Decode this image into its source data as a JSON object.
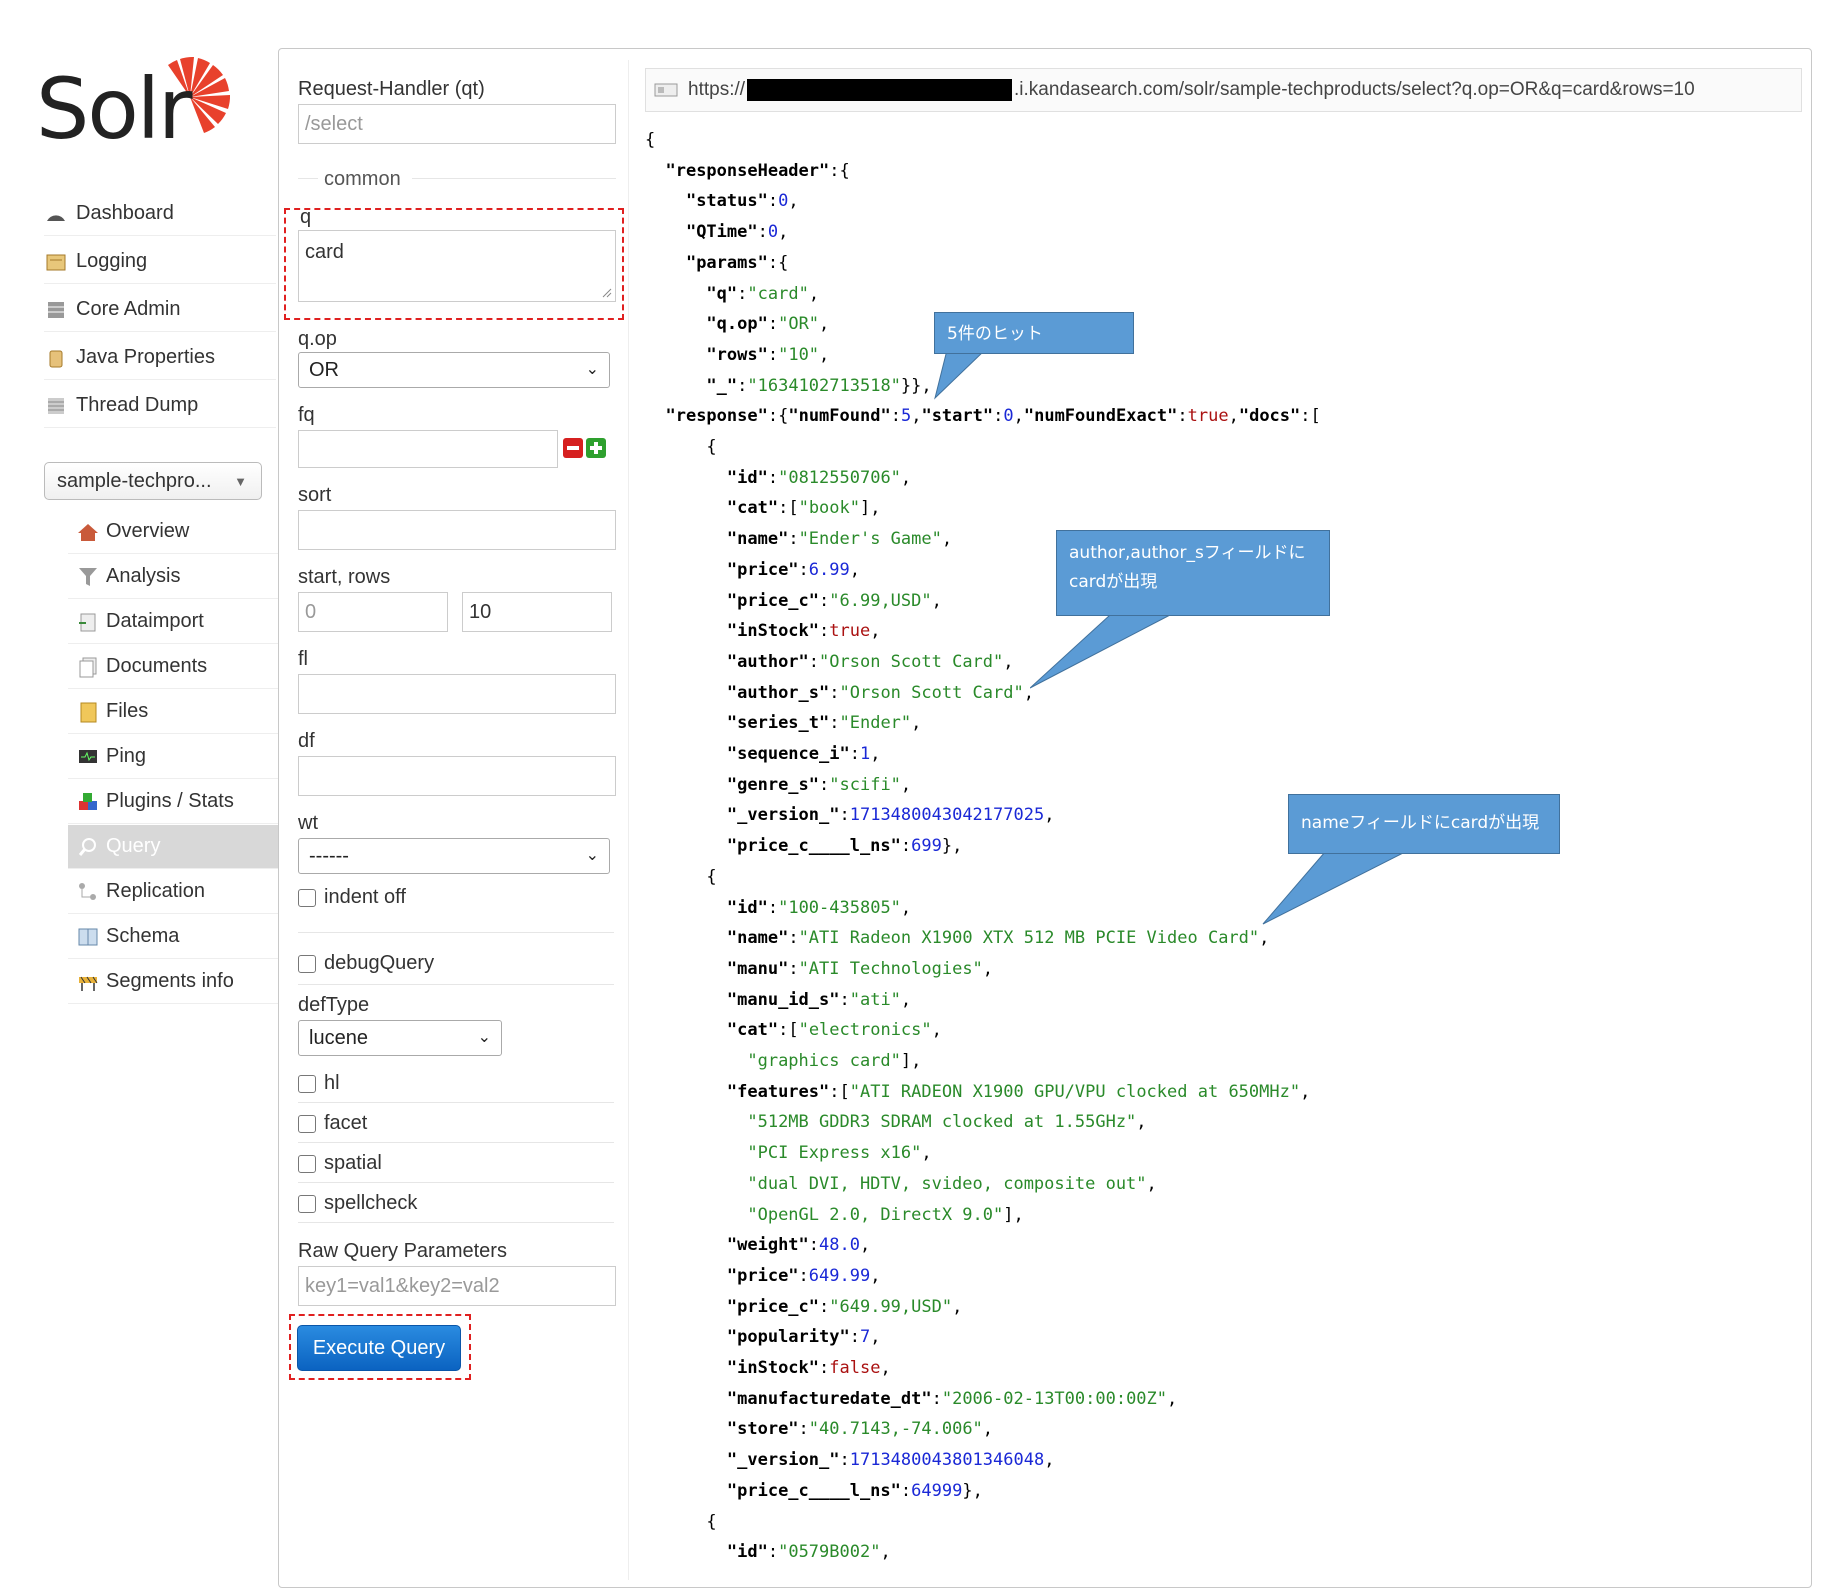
{
  "logo_text": "Solr",
  "sidebar": {
    "items": [
      {
        "label": "Dashboard",
        "icon": "dashboard-icon"
      },
      {
        "label": "Logging",
        "icon": "logging-icon"
      },
      {
        "label": "Core Admin",
        "icon": "core-admin-icon"
      },
      {
        "label": "Java Properties",
        "icon": "java-properties-icon"
      },
      {
        "label": "Thread Dump",
        "icon": "thread-dump-icon"
      }
    ],
    "core_selector": "sample-techpro...",
    "core_items": [
      {
        "label": "Overview",
        "icon": "overview-icon"
      },
      {
        "label": "Analysis",
        "icon": "analysis-icon"
      },
      {
        "label": "Dataimport",
        "icon": "dataimport-icon"
      },
      {
        "label": "Documents",
        "icon": "documents-icon"
      },
      {
        "label": "Files",
        "icon": "files-icon"
      },
      {
        "label": "Ping",
        "icon": "ping-icon"
      },
      {
        "label": "Plugins / Stats",
        "icon": "plugins-icon"
      },
      {
        "label": "Query",
        "icon": "query-icon",
        "active": true
      },
      {
        "label": "Replication",
        "icon": "replication-icon"
      },
      {
        "label": "Schema",
        "icon": "schema-icon"
      },
      {
        "label": "Segments info",
        "icon": "segments-icon"
      }
    ]
  },
  "form": {
    "handler_label": "Request-Handler (qt)",
    "handler_placeholder": "/select",
    "common_label": "common",
    "q_label": "q",
    "q_value": "card",
    "qop_label": "q.op",
    "qop_value": "OR",
    "fq_label": "fq",
    "sort_label": "sort",
    "start_rows_label": "start, rows",
    "start_placeholder": "0",
    "rows_value": "10",
    "fl_label": "fl",
    "df_label": "df",
    "wt_label": "wt",
    "wt_value": "------",
    "indent_label": "indent off",
    "debug_label": "debugQuery",
    "deftype_label": "defType",
    "deftype_value": "lucene",
    "hl_label": "hl",
    "facet_label": "facet",
    "spatial_label": "spatial",
    "spellcheck_label": "spellcheck",
    "raw_label": "Raw Query Parameters",
    "raw_placeholder": "key1=val1&key2=val2",
    "execute_label": "Execute Query"
  },
  "url": {
    "prefix": "https://",
    "suffix": ".i.kandasearch.com/solr/sample-techproducts/select?q.op=OR&q=card&rows=10"
  },
  "json_lines": [
    "{",
    "  \"responseHeader\":{",
    "    \"status\":0,",
    "    \"QTime\":0,",
    "    \"params\":{",
    "      \"q\":\"card\",",
    "      \"q.op\":\"OR\",",
    "      \"rows\":\"10\",",
    "      \"_\":\"1634102713518\"}},",
    "  \"response\":{\"numFound\":5,\"start\":0,\"numFoundExact\":true,\"docs\":[",
    "      {",
    "        \"id\":\"0812550706\",",
    "        \"cat\":[\"book\"],",
    "        \"name\":\"Ender's Game\",",
    "        \"price\":6.99,",
    "        \"price_c\":\"6.99,USD\",",
    "        \"inStock\":true,",
    "        \"author\":\"Orson Scott Card\",",
    "        \"author_s\":\"Orson Scott Card\",",
    "        \"series_t\":\"Ender\",",
    "        \"sequence_i\":1,",
    "        \"genre_s\":\"scifi\",",
    "        \"_version_\":1713480043042177025,",
    "        \"price_c____l_ns\":699},",
    "      {",
    "        \"id\":\"100-435805\",",
    "        \"name\":\"ATI Radeon X1900 XTX 512 MB PCIE Video Card\",",
    "        \"manu\":\"ATI Technologies\",",
    "        \"manu_id_s\":\"ati\",",
    "        \"cat\":[\"electronics\",",
    "          \"graphics card\"],",
    "        \"features\":[\"ATI RADEON X1900 GPU/VPU clocked at 650MHz\",",
    "          \"512MB GDDR3 SDRAM clocked at 1.55GHz\",",
    "          \"PCI Express x16\",",
    "          \"dual DVI, HDTV, svideo, composite out\",",
    "          \"OpenGL 2.0, DirectX 9.0\"],",
    "        \"weight\":48.0,",
    "        \"price\":649.99,",
    "        \"price_c\":\"649.99,USD\",",
    "        \"popularity\":7,",
    "        \"inStock\":false,",
    "        \"manufacturedate_dt\":\"2006-02-13T00:00:00Z\",",
    "        \"store\":\"40.7143,-74.006\",",
    "        \"_version_\":1713480043801346048,",
    "        \"price_c____l_ns\":64999},",
    "      {",
    "        \"id\":\"0579B002\","
  ],
  "callouts": {
    "hits": "5件のヒット",
    "author_line1": "author,author_sフィールドに",
    "author_line2": "cardが出現",
    "name": "nameフィールドにcardが出現"
  },
  "colors": {
    "accent_button": "#0b63c1",
    "callout": "#5b9bd5",
    "highlight_dash": "#e02020",
    "json_string": "#2a8a2a",
    "json_number": "#1a28d6",
    "json_bool": "#a11"
  }
}
